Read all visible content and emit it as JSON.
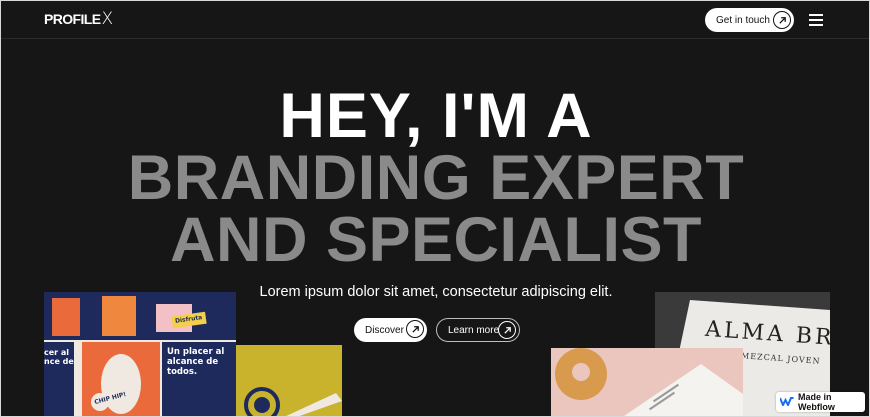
{
  "nav": {
    "logo_text": "PROFILE",
    "logo_mark": "X",
    "cta_label": "Get in touch",
    "cta_icon": "arrow-up-right-icon",
    "menu_icon": "hamburger-menu-icon"
  },
  "hero": {
    "line1": "HEY, I'M A",
    "line2": "BRANDING EXPERT",
    "line3": "AND SPECIALIST",
    "subtitle": "Lorem ipsum dolor sit amet, consectetur adipiscing elit.",
    "primary_button": "Discover",
    "secondary_button": "Learn more"
  },
  "gallery": {
    "poster_text_1": "Un placer al alcance de todos.",
    "poster_text_left": "cer al nce de",
    "poster_tag": "Disfruta",
    "sticker_text": "CHIP HIP!",
    "card_text_1": "ALMA BRA",
    "card_text_2": "MEZCAL JOVEN"
  },
  "badge": {
    "label": "Made in Webflow"
  },
  "colors": {
    "background": "#161616",
    "headline_primary": "#ffffff",
    "headline_secondary": "#8a8a8a"
  }
}
